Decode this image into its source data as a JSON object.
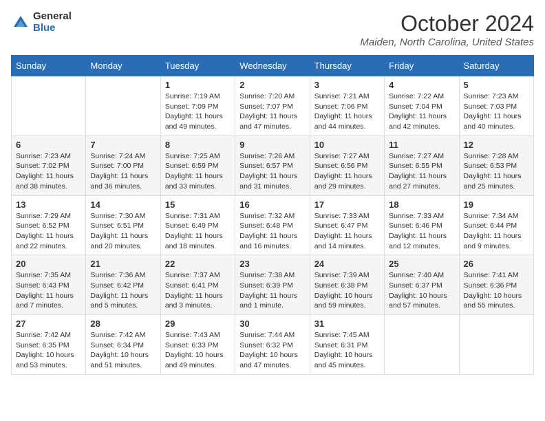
{
  "logo": {
    "general": "General",
    "blue": "Blue"
  },
  "title": "October 2024",
  "location": "Maiden, North Carolina, United States",
  "days_of_week": [
    "Sunday",
    "Monday",
    "Tuesday",
    "Wednesday",
    "Thursday",
    "Friday",
    "Saturday"
  ],
  "weeks": [
    [
      {
        "day": "",
        "info": ""
      },
      {
        "day": "",
        "info": ""
      },
      {
        "day": "1",
        "info": "Sunrise: 7:19 AM\nSunset: 7:09 PM\nDaylight: 11 hours and 49 minutes."
      },
      {
        "day": "2",
        "info": "Sunrise: 7:20 AM\nSunset: 7:07 PM\nDaylight: 11 hours and 47 minutes."
      },
      {
        "day": "3",
        "info": "Sunrise: 7:21 AM\nSunset: 7:06 PM\nDaylight: 11 hours and 44 minutes."
      },
      {
        "day": "4",
        "info": "Sunrise: 7:22 AM\nSunset: 7:04 PM\nDaylight: 11 hours and 42 minutes."
      },
      {
        "day": "5",
        "info": "Sunrise: 7:23 AM\nSunset: 7:03 PM\nDaylight: 11 hours and 40 minutes."
      }
    ],
    [
      {
        "day": "6",
        "info": "Sunrise: 7:23 AM\nSunset: 7:02 PM\nDaylight: 11 hours and 38 minutes."
      },
      {
        "day": "7",
        "info": "Sunrise: 7:24 AM\nSunset: 7:00 PM\nDaylight: 11 hours and 36 minutes."
      },
      {
        "day": "8",
        "info": "Sunrise: 7:25 AM\nSunset: 6:59 PM\nDaylight: 11 hours and 33 minutes."
      },
      {
        "day": "9",
        "info": "Sunrise: 7:26 AM\nSunset: 6:57 PM\nDaylight: 11 hours and 31 minutes."
      },
      {
        "day": "10",
        "info": "Sunrise: 7:27 AM\nSunset: 6:56 PM\nDaylight: 11 hours and 29 minutes."
      },
      {
        "day": "11",
        "info": "Sunrise: 7:27 AM\nSunset: 6:55 PM\nDaylight: 11 hours and 27 minutes."
      },
      {
        "day": "12",
        "info": "Sunrise: 7:28 AM\nSunset: 6:53 PM\nDaylight: 11 hours and 25 minutes."
      }
    ],
    [
      {
        "day": "13",
        "info": "Sunrise: 7:29 AM\nSunset: 6:52 PM\nDaylight: 11 hours and 22 minutes."
      },
      {
        "day": "14",
        "info": "Sunrise: 7:30 AM\nSunset: 6:51 PM\nDaylight: 11 hours and 20 minutes."
      },
      {
        "day": "15",
        "info": "Sunrise: 7:31 AM\nSunset: 6:49 PM\nDaylight: 11 hours and 18 minutes."
      },
      {
        "day": "16",
        "info": "Sunrise: 7:32 AM\nSunset: 6:48 PM\nDaylight: 11 hours and 16 minutes."
      },
      {
        "day": "17",
        "info": "Sunrise: 7:33 AM\nSunset: 6:47 PM\nDaylight: 11 hours and 14 minutes."
      },
      {
        "day": "18",
        "info": "Sunrise: 7:33 AM\nSunset: 6:46 PM\nDaylight: 11 hours and 12 minutes."
      },
      {
        "day": "19",
        "info": "Sunrise: 7:34 AM\nSunset: 6:44 PM\nDaylight: 11 hours and 9 minutes."
      }
    ],
    [
      {
        "day": "20",
        "info": "Sunrise: 7:35 AM\nSunset: 6:43 PM\nDaylight: 11 hours and 7 minutes."
      },
      {
        "day": "21",
        "info": "Sunrise: 7:36 AM\nSunset: 6:42 PM\nDaylight: 11 hours and 5 minutes."
      },
      {
        "day": "22",
        "info": "Sunrise: 7:37 AM\nSunset: 6:41 PM\nDaylight: 11 hours and 3 minutes."
      },
      {
        "day": "23",
        "info": "Sunrise: 7:38 AM\nSunset: 6:39 PM\nDaylight: 11 hours and 1 minute."
      },
      {
        "day": "24",
        "info": "Sunrise: 7:39 AM\nSunset: 6:38 PM\nDaylight: 10 hours and 59 minutes."
      },
      {
        "day": "25",
        "info": "Sunrise: 7:40 AM\nSunset: 6:37 PM\nDaylight: 10 hours and 57 minutes."
      },
      {
        "day": "26",
        "info": "Sunrise: 7:41 AM\nSunset: 6:36 PM\nDaylight: 10 hours and 55 minutes."
      }
    ],
    [
      {
        "day": "27",
        "info": "Sunrise: 7:42 AM\nSunset: 6:35 PM\nDaylight: 10 hours and 53 minutes."
      },
      {
        "day": "28",
        "info": "Sunrise: 7:42 AM\nSunset: 6:34 PM\nDaylight: 10 hours and 51 minutes."
      },
      {
        "day": "29",
        "info": "Sunrise: 7:43 AM\nSunset: 6:33 PM\nDaylight: 10 hours and 49 minutes."
      },
      {
        "day": "30",
        "info": "Sunrise: 7:44 AM\nSunset: 6:32 PM\nDaylight: 10 hours and 47 minutes."
      },
      {
        "day": "31",
        "info": "Sunrise: 7:45 AM\nSunset: 6:31 PM\nDaylight: 10 hours and 45 minutes."
      },
      {
        "day": "",
        "info": ""
      },
      {
        "day": "",
        "info": ""
      }
    ]
  ]
}
